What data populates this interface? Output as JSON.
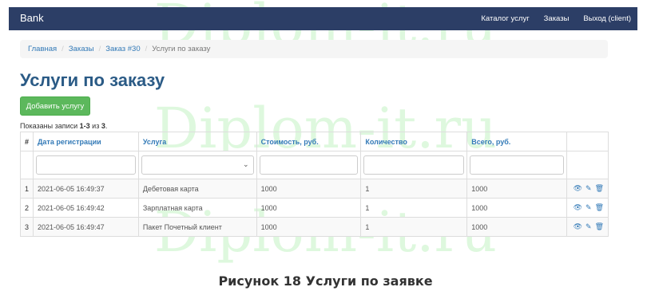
{
  "navbar": {
    "brand": "Bank",
    "links": [
      "Каталог услуг",
      "Заказы",
      "Выход (client)"
    ]
  },
  "breadcrumb": [
    "Главная",
    "Заказы",
    "Заказ #30",
    "Услуги по заказу"
  ],
  "title": "Услуги по заказу",
  "add_button": "Добавить услугу",
  "summary": {
    "prefix": "Показаны записи ",
    "range": "1-3",
    "middle": " из ",
    "total": "3",
    "suffix": "."
  },
  "table": {
    "headers": [
      "#",
      "Дата регистрации",
      "Услуга",
      "Стоимость, руб.",
      "Количество",
      "Всего, руб."
    ],
    "rows": [
      [
        "1",
        "2021-06-05 16:49:37",
        "Дебетовая карта",
        "1000",
        "1",
        "1000"
      ],
      [
        "2",
        "2021-06-05 16:49:42",
        "Зарплатная карта",
        "1000",
        "1",
        "1000"
      ],
      [
        "3",
        "2021-06-05 16:49:47",
        "Пакет Почетный клиент",
        "1000",
        "1",
        "1000"
      ]
    ],
    "action_icons": [
      "eye-icon",
      "pencil-icon",
      "trash-icon"
    ]
  },
  "watermark": "Diplom-it.ru",
  "caption": "Рисунок 18 Услуги по заявке"
}
